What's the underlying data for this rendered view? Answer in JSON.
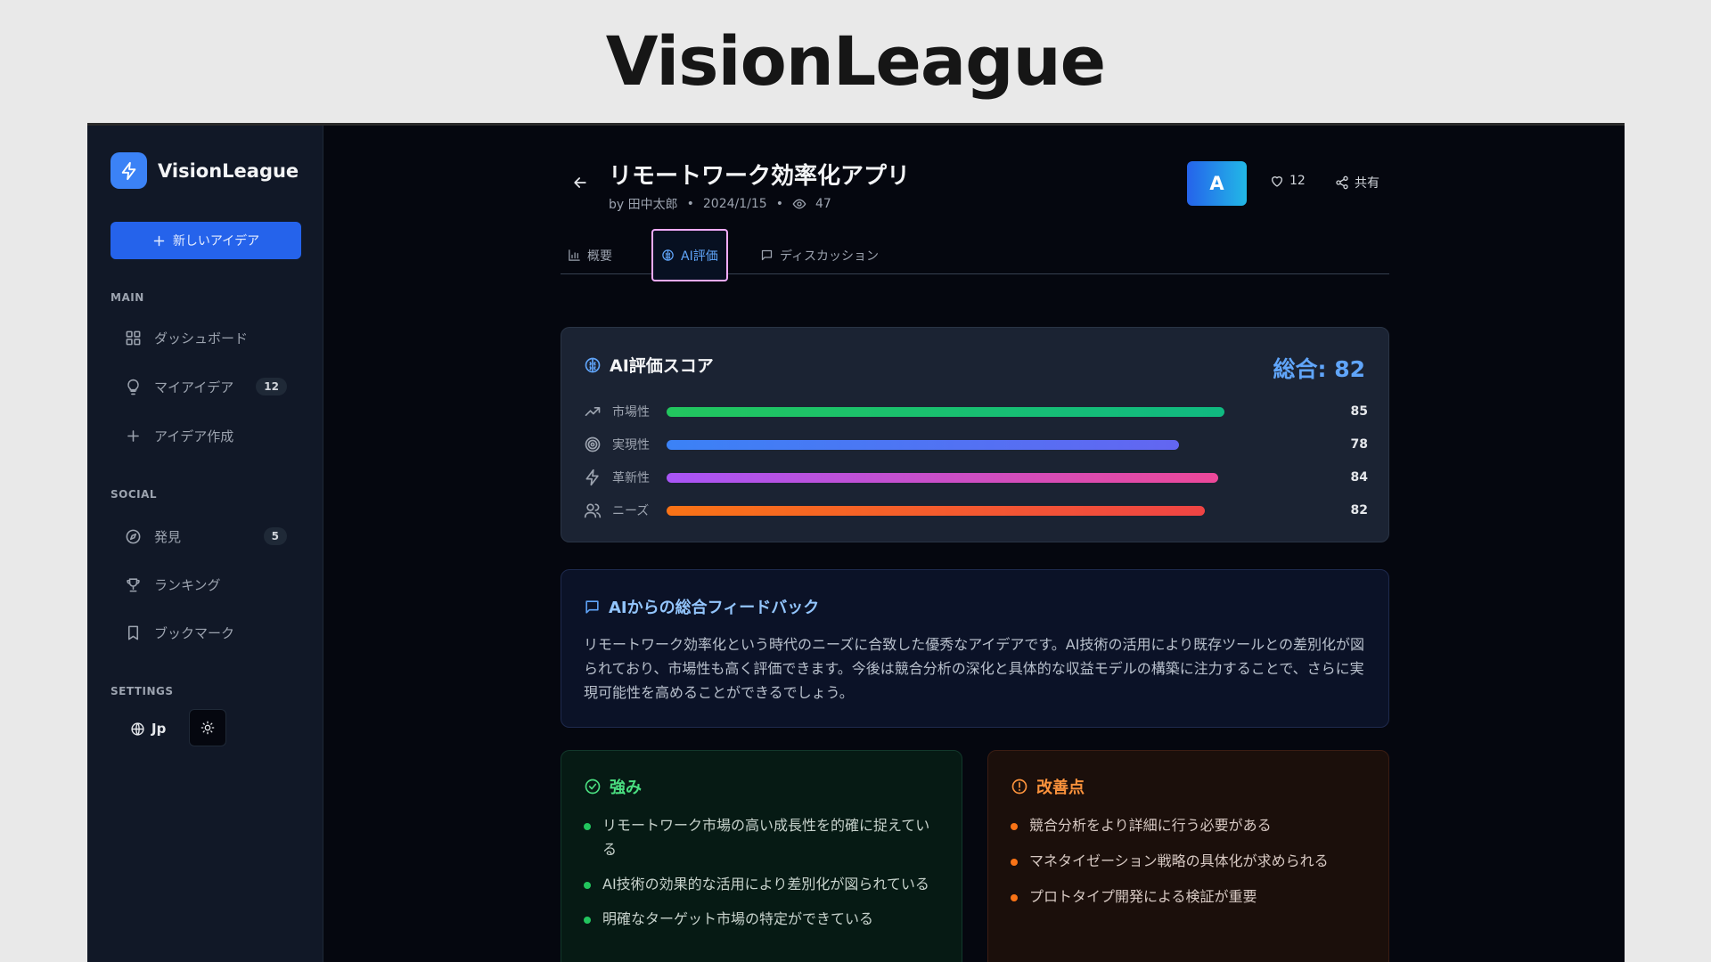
{
  "page_heading": "VisionLeague",
  "sidebar": {
    "brand": "VisionLeague",
    "new_idea_label": "新しいアイデア",
    "sections": {
      "main": "MAIN",
      "social": "SOCIAL",
      "settings": "SETTINGS"
    },
    "main_items": [
      {
        "label": "ダッシュボード",
        "icon": "grid-icon"
      },
      {
        "label": "マイアイデア",
        "icon": "lightbulb-icon",
        "badge": "12"
      },
      {
        "label": "アイデア作成",
        "icon": "plus-icon"
      }
    ],
    "social_items": [
      {
        "label": "発見",
        "icon": "compass-icon",
        "badge": "5"
      },
      {
        "label": "ランキング",
        "icon": "trophy-icon"
      },
      {
        "label": "ブックマーク",
        "icon": "bookmark-icon"
      }
    ],
    "language": "Jp"
  },
  "header": {
    "title": "リモートワーク効率化アプリ",
    "author": "by 田中太郎",
    "date": "2024/1/15",
    "views": "47",
    "grade": "A",
    "likes": "12",
    "share_label": "共有"
  },
  "tabs": [
    {
      "label": "概要",
      "active": false
    },
    {
      "label": "AI評価",
      "active": true
    },
    {
      "label": "ディスカッション",
      "active": false
    }
  ],
  "score": {
    "title": "AI評価スコア",
    "total_label": "総合: 82",
    "max": 100,
    "metrics": [
      {
        "label": "市場性",
        "value": 85,
        "gradient": [
          "#22c55e",
          "#10b981"
        ],
        "icon": "trend-up-icon"
      },
      {
        "label": "実現性",
        "value": 78,
        "gradient": [
          "#3b82f6",
          "#6366f1"
        ],
        "icon": "target-icon"
      },
      {
        "label": "革新性",
        "value": 84,
        "gradient": [
          "#a855f7",
          "#ec4899"
        ],
        "icon": "lightning-icon"
      },
      {
        "label": "ニーズ",
        "value": 82,
        "gradient": [
          "#f97316",
          "#ef4444"
        ],
        "icon": "users-icon"
      }
    ]
  },
  "feedback": {
    "title": "AIからの総合フィードバック",
    "text": "リモートワーク効率化という時代のニーズに合致した優秀なアイデアです。AI技術の活用により既存ツールとの差別化が図られており、市場性も高く評価できます。今後は競合分析の深化と具体的な収益モデルの構築に注力することで、さらに実現可能性を高めることができるでしょう。"
  },
  "strengths": {
    "title": "強み",
    "items": [
      "リモートワーク市場の高い成長性を的確に捉えている",
      "AI技術の効果的な活用により差別化が図られている",
      "明確なターゲット市場の特定ができている"
    ]
  },
  "improvements": {
    "title": "改善点",
    "items": [
      "競合分析をより詳細に行う必要がある",
      "マネタイゼーション戦略の具体化が求められる",
      "プロトタイプ開発による検証が重要"
    ]
  },
  "colors": {
    "accent": "#3b82f6",
    "total_score": "#60a5fa",
    "strength": "#22c55e",
    "improvement": "#f97316"
  }
}
